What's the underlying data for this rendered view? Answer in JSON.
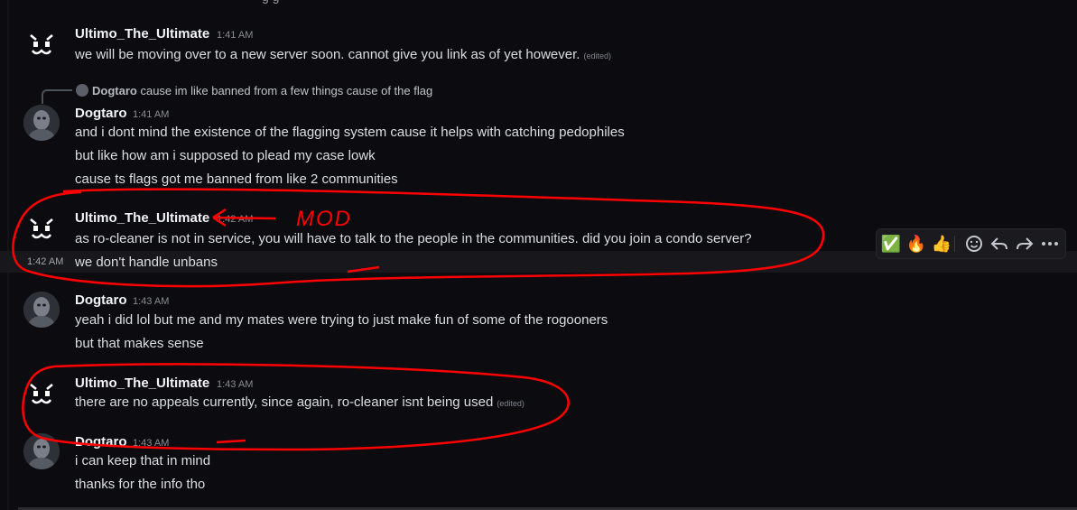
{
  "top_cut_text": "g          g",
  "messages": [
    {
      "author": "Ultimo_The_Ultimate",
      "time": "1:41 AM",
      "lines": [
        "we will be moving over to a new server soon. cannot give you link as of yet however."
      ],
      "edited": "(edited)"
    },
    {
      "reply_to": {
        "author": "Dogtaro",
        "text": "cause im like banned from a few things cause of the flag"
      },
      "author": "Dogtaro",
      "time": "1:41 AM",
      "lines": [
        "and i dont mind the existence of the flagging system cause it helps with catching pedophiles",
        "but like how am i supposed to plead my case lowk",
        "cause ts flags got me banned from like 2 communities"
      ]
    },
    {
      "author": "Ultimo_The_Ultimate",
      "time": "1:42 AM",
      "lines": [
        "as ro-cleaner is not in service, you will have to talk to the people in the communities. did you join a condo server?",
        "we don't handle unbans"
      ],
      "hover_time": "1:42 AM"
    },
    {
      "author": "Dogtaro",
      "time": "1:43 AM",
      "lines": [
        "yeah i did lol but me and my mates were trying to just make fun of some of the rogooners",
        "but that makes sense"
      ]
    },
    {
      "author": "Ultimo_The_Ultimate",
      "time": "1:43 AM",
      "lines": [
        "there are no appeals currently, since again, ro-cleaner isnt being used"
      ],
      "edited": "(edited)"
    },
    {
      "author": "Dogtaro",
      "time": "1:43 AM",
      "lines": [
        "i can keep that in mind",
        "thanks for the info tho"
      ]
    }
  ],
  "toolbar": {
    "reactions": [
      "✅",
      "🔥",
      "👍"
    ],
    "actions": [
      "add-reaction",
      "reply",
      "forward",
      "more"
    ]
  },
  "annotation": {
    "label": "MOD",
    "color": "#ff0000"
  }
}
